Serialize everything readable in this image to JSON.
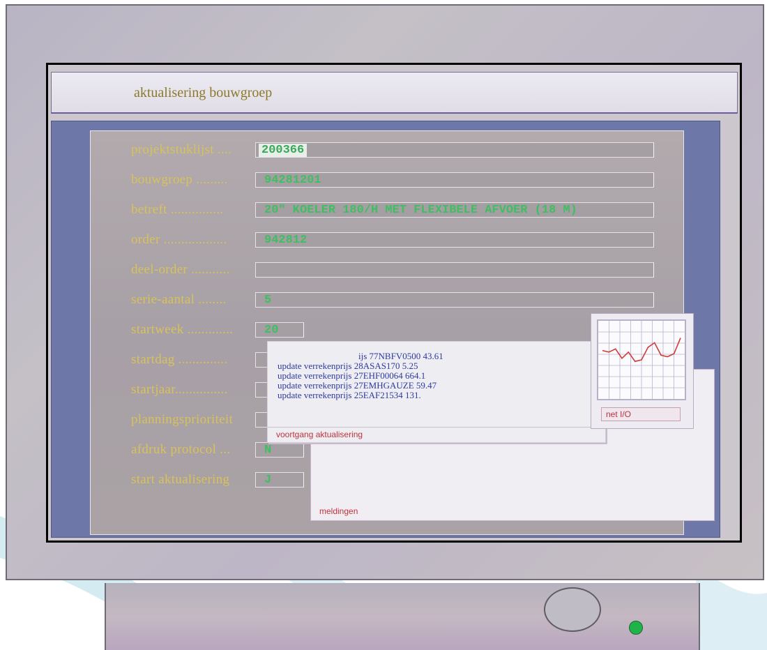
{
  "window": {
    "title": "aktualisering bouwgroep"
  },
  "form": {
    "fields": [
      {
        "label": "projektstuklijst ....",
        "value": "200366",
        "width": 572,
        "highlight": true
      },
      {
        "label": "bouwgroep .........",
        "value": "94281201",
        "width": 572
      },
      {
        "label": "betreft ...............",
        "value": "20\" KOELER 180/H MET FLEXIBELE AFVOER (18 M)",
        "width": 572
      },
      {
        "label": "order ..................",
        "value": "942812",
        "width": 572
      },
      {
        "label": "deel-order ...........",
        "value": "",
        "width": 572
      },
      {
        "label": "serie-aantal ........",
        "value": "5",
        "width": 572
      },
      {
        "label": "startweek .............",
        "value": "20",
        "width": 70
      },
      {
        "label": "startdag ..............",
        "value": "",
        "width": 70
      },
      {
        "label": "startjaar...............",
        "value": "",
        "width": 70
      },
      {
        "label": "planningsprioriteit",
        "value": "",
        "width": 70
      },
      {
        "label": "afdruk protocol ...",
        "value": "N",
        "width": 70
      },
      {
        "label": "start aktualisering",
        "value": "J",
        "width": 70
      }
    ]
  },
  "progress_window": {
    "title": "voortgang aktualisering",
    "lines": [
      "ijs 77NBFV0500 43.61",
      "update verrekenprijs 28ASAS170 5.25",
      "update verrekenprijs 27EHF00064 664.1",
      "update verrekenprijs 27EMHGAUZE 59.47",
      "update verrekenprijs 25EAF21534 131."
    ]
  },
  "messages_window": {
    "title": "meldingen"
  },
  "net_window": {
    "label": "net I/O",
    "line_color": "#d03a3a",
    "samples": [
      0.62,
      0.6,
      0.64,
      0.52,
      0.6,
      0.48,
      0.5,
      0.66,
      0.72,
      0.56,
      0.54,
      0.58,
      0.78
    ]
  }
}
